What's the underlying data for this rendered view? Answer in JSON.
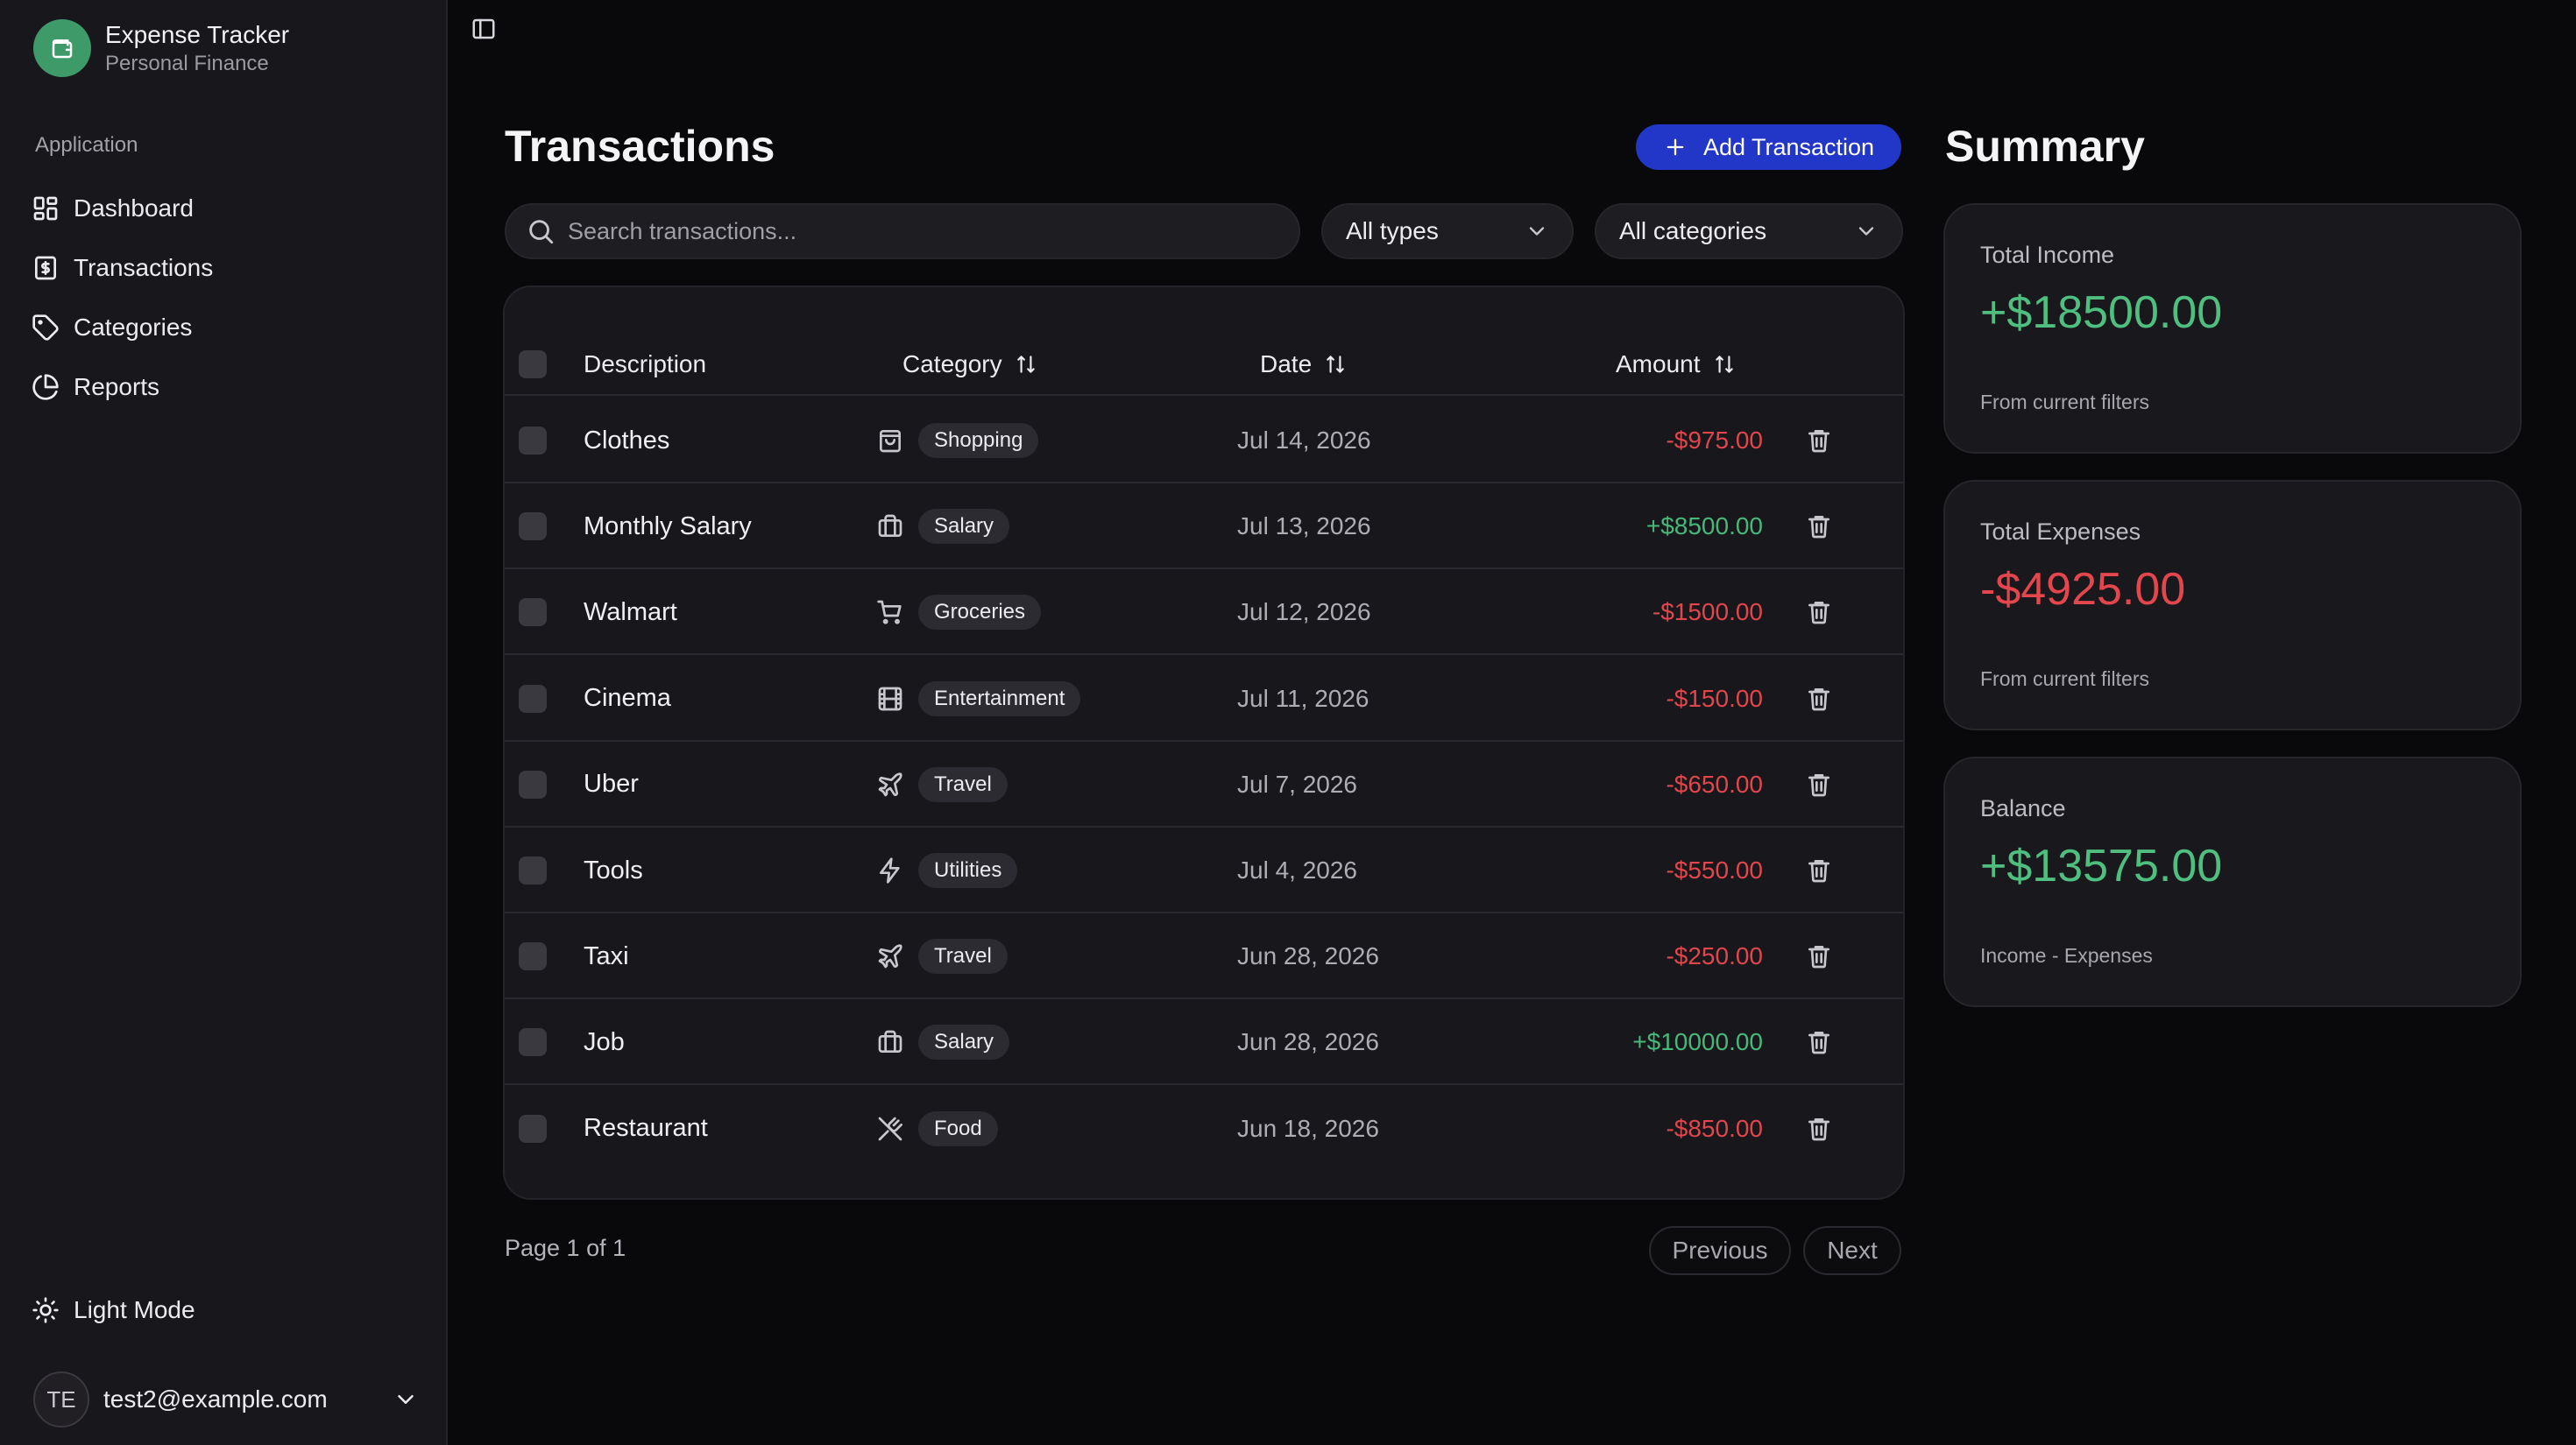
{
  "app": {
    "title": "Expense Tracker",
    "subtitle": "Personal Finance"
  },
  "sidebar": {
    "group_label": "Application",
    "items": [
      {
        "label": "Dashboard",
        "icon": "dashboard-icon"
      },
      {
        "label": "Transactions",
        "icon": "receipt-icon"
      },
      {
        "label": "Categories",
        "icon": "tag-icon"
      },
      {
        "label": "Reports",
        "icon": "pie-chart-icon"
      }
    ],
    "theme_toggle": "Light Mode",
    "user": {
      "initials": "TE",
      "email": "test2@example.com"
    }
  },
  "main": {
    "title": "Transactions",
    "add_button": "Add Transaction",
    "search_placeholder": "Search transactions...",
    "filter_type": "All types",
    "filter_category": "All categories",
    "columns": {
      "description": "Description",
      "category": "Category",
      "date": "Date",
      "amount": "Amount"
    },
    "rows": [
      {
        "description": "Clothes",
        "category": "Shopping",
        "icon": "shopping-bag-icon",
        "date": "Jul 14, 2026",
        "amount": "-$975.00",
        "type": "expense"
      },
      {
        "description": "Monthly Salary",
        "category": "Salary",
        "icon": "briefcase-icon",
        "date": "Jul 13, 2026",
        "amount": "+$8500.00",
        "type": "income"
      },
      {
        "description": "Walmart",
        "category": "Groceries",
        "icon": "shopping-cart-icon",
        "date": "Jul 12, 2026",
        "amount": "-$1500.00",
        "type": "expense"
      },
      {
        "description": "Cinema",
        "category": "Entertainment",
        "icon": "film-icon",
        "date": "Jul 11, 2026",
        "amount": "-$150.00",
        "type": "expense"
      },
      {
        "description": "Uber",
        "category": "Travel",
        "icon": "plane-icon",
        "date": "Jul 7, 2026",
        "amount": "-$650.00",
        "type": "expense"
      },
      {
        "description": "Tools",
        "category": "Utilities",
        "icon": "zap-icon",
        "date": "Jul 4, 2026",
        "amount": "-$550.00",
        "type": "expense"
      },
      {
        "description": "Taxi",
        "category": "Travel",
        "icon": "plane-icon",
        "date": "Jun 28, 2026",
        "amount": "-$250.00",
        "type": "expense"
      },
      {
        "description": "Job",
        "category": "Salary",
        "icon": "briefcase-icon",
        "date": "Jun 28, 2026",
        "amount": "+$10000.00",
        "type": "income"
      },
      {
        "description": "Restaurant",
        "category": "Food",
        "icon": "utensils-icon",
        "date": "Jun 18, 2026",
        "amount": "-$850.00",
        "type": "expense"
      }
    ],
    "pagination": {
      "info": "Page 1 of 1",
      "previous": "Previous",
      "next": "Next"
    }
  },
  "summary": {
    "title": "Summary",
    "cards": [
      {
        "label": "Total Income",
        "value": "+$18500.00",
        "note": "From current filters",
        "tone": "positive"
      },
      {
        "label": "Total Expenses",
        "value": "-$4925.00",
        "note": "From current filters",
        "tone": "negative"
      },
      {
        "label": "Balance",
        "value": "+$13575.00",
        "note": "Income - Expenses",
        "tone": "positive"
      }
    ]
  },
  "colors": {
    "accent": "#2237c8",
    "income": "#48b87a",
    "expense": "#e0464c",
    "brand": "#3f9a6a"
  }
}
